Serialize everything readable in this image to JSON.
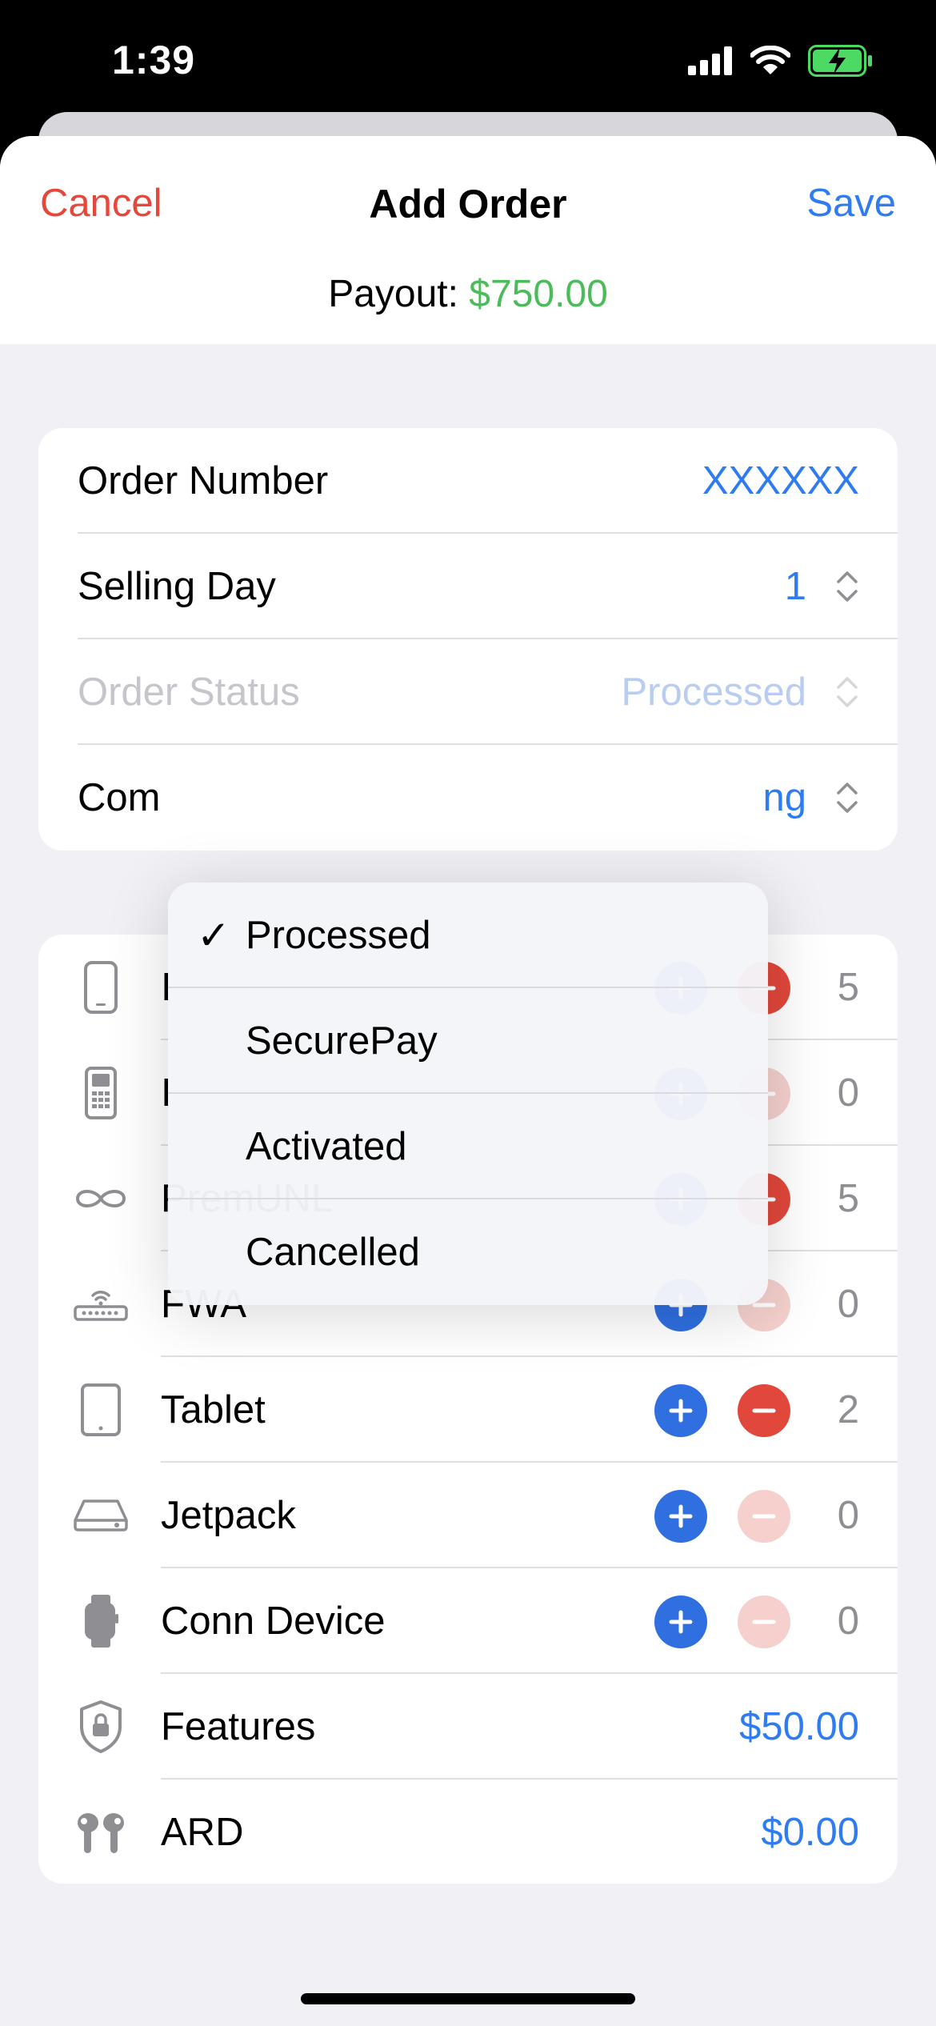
{
  "status_bar": {
    "time": "1:39",
    "icons": [
      "cellular-signal-icon",
      "wifi-icon",
      "battery-charging-icon"
    ]
  },
  "nav": {
    "cancel": "Cancel",
    "title": "Add Order",
    "save": "Save"
  },
  "payout": {
    "label": "Payout: ",
    "value": "$750.00"
  },
  "order_form": {
    "order_number": {
      "label": "Order Number",
      "value": "XXXXXX"
    },
    "selling_day": {
      "label": "Selling Day",
      "value": "1"
    },
    "order_status": {
      "label": "Order Status",
      "value": "Processed"
    },
    "commission_row": {
      "label": "Com",
      "value": "ng"
    }
  },
  "status_menu": {
    "options": [
      "Processed",
      "SecurePay",
      "Activated",
      "Cancelled"
    ],
    "selected": "Processed",
    "check": "✓"
  },
  "products": [
    {
      "label": "I",
      "icon": "smartphone-icon",
      "count": "5",
      "minus_enabled": true
    },
    {
      "label": "I",
      "icon": "basic-phone-icon",
      "count": "0",
      "minus_enabled": false
    },
    {
      "label": "PremUNL",
      "icon": "infinity-icon",
      "count": "5",
      "minus_enabled": true
    },
    {
      "label": "FWA",
      "icon": "router-icon",
      "count": "0",
      "minus_enabled": false
    },
    {
      "label": "Tablet",
      "icon": "tablet-icon",
      "count": "2",
      "minus_enabled": true
    },
    {
      "label": "Jetpack",
      "icon": "hotspot-icon",
      "count": "0",
      "minus_enabled": false
    },
    {
      "label": "Conn Device",
      "icon": "watch-icon",
      "count": "0",
      "minus_enabled": false
    }
  ],
  "extras": [
    {
      "label": "Features",
      "icon": "shield-lock-icon",
      "value": "$50.00"
    },
    {
      "label": "ARD",
      "icon": "earbuds-icon",
      "value": "$0.00"
    }
  ],
  "colors": {
    "accent": "#2f7bf0",
    "destructive": "#e5483b",
    "positive": "#4cbb59",
    "background": "#f0f0f5"
  }
}
